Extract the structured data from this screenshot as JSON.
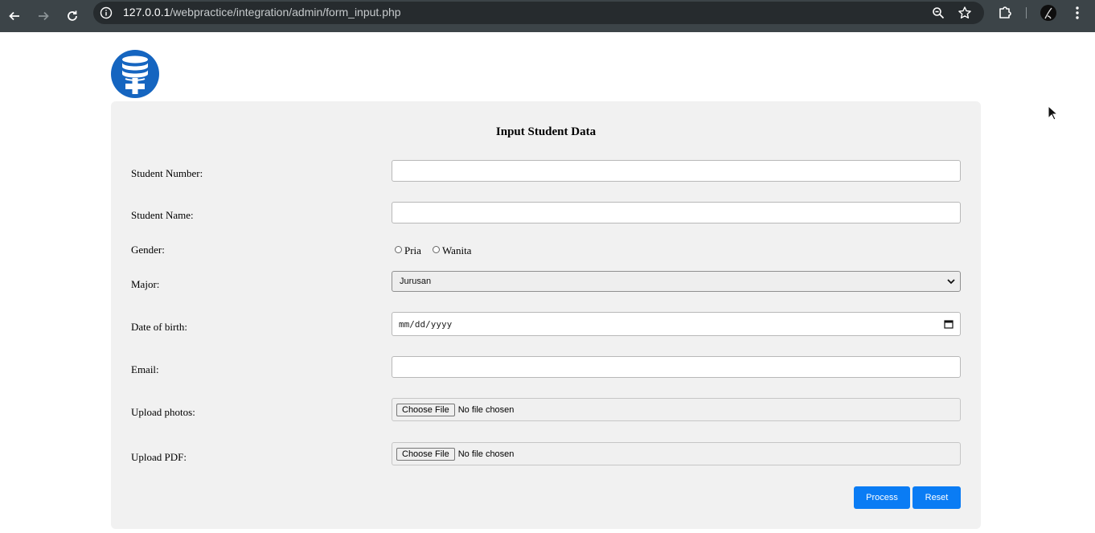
{
  "browser": {
    "url_host": "127.0.0.1",
    "url_path": "/webpractice/integration/admin/form_input.php",
    "icons": {
      "back": "arrow-left-icon",
      "forward": "arrow-right-icon",
      "reload": "reload-icon",
      "info": "info-icon",
      "zoom": "zoom-icon",
      "bookmark": "star-icon",
      "extensions": "puzzle-icon",
      "profile": "avatar",
      "menu": "kebab-menu-icon"
    }
  },
  "page": {
    "logo": "database-plus-logo",
    "form_title": "Input Student Data",
    "labels": {
      "student_number": "Student Number:",
      "student_name": "Student Name:",
      "gender": "Gender:",
      "major": "Major:",
      "dob": "Date of birth:",
      "email": "Email:",
      "upload_photos": "Upload photos:",
      "upload_pdf": "Upload PDF:"
    },
    "student_number_value": "",
    "student_name_value": "",
    "gender_options": [
      "Pria",
      "Wanita"
    ],
    "major_selected": "Jurusan",
    "dob_placeholder": "mm/dd/yyyy",
    "email_value": "",
    "file_button_label": "Choose File",
    "file_status": "No file chosen",
    "buttons": {
      "process": "Process",
      "reset": "Reset"
    },
    "colors": {
      "accent": "#0a7cf4",
      "card_bg": "#f1f1f1",
      "logo": "#1565c0"
    }
  }
}
